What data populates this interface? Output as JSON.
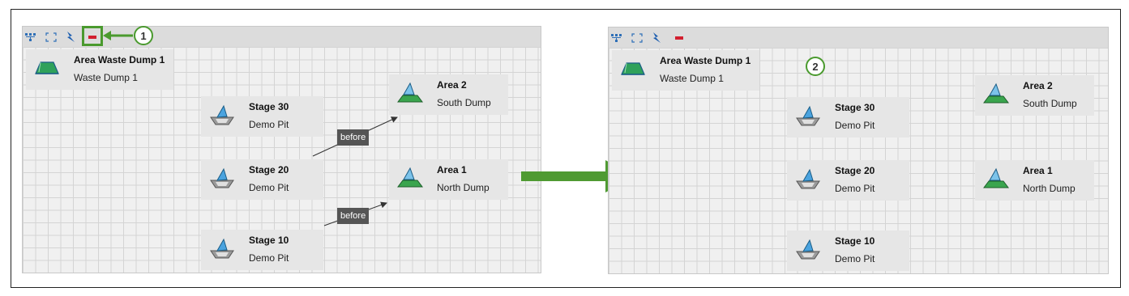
{
  "left": {
    "toolbar": {
      "icons": [
        "hierarchy-icon",
        "fit-view-icon",
        "auto-layout-icon",
        "remove-dependency-icon"
      ]
    },
    "nodes": [
      {
        "title": "Area Waste Dump 1",
        "sub": "Waste Dump 1",
        "icon": "waste-dump-icon"
      },
      {
        "title": "Stage 30",
        "sub": "Demo Pit",
        "icon": "pit-stage-icon"
      },
      {
        "title": "Stage 20",
        "sub": "Demo Pit",
        "icon": "pit-stage-icon"
      },
      {
        "title": "Stage 10",
        "sub": "Demo Pit",
        "icon": "pit-stage-icon"
      },
      {
        "title": "Area 2",
        "sub": "South Dump",
        "icon": "dump-area-icon"
      },
      {
        "title": "Area 1",
        "sub": "North Dump",
        "icon": "dump-area-icon"
      }
    ],
    "tags": [
      "before",
      "before"
    ],
    "callout": "1"
  },
  "right": {
    "nodes": [
      {
        "title": "Area Waste Dump 1",
        "sub": "Waste Dump 1"
      },
      {
        "title": "Stage 30",
        "sub": "Demo Pit"
      },
      {
        "title": "Stage 20",
        "sub": "Demo Pit"
      },
      {
        "title": "Stage 10",
        "sub": "Demo Pit"
      },
      {
        "title": "Area 2",
        "sub": "South Dump"
      },
      {
        "title": "Area 1",
        "sub": "North Dump"
      }
    ],
    "callout": "2"
  },
  "colors": {
    "highlight": "#4a9a2e",
    "remove": "#d21f2f",
    "tag_bg": "#555555"
  }
}
